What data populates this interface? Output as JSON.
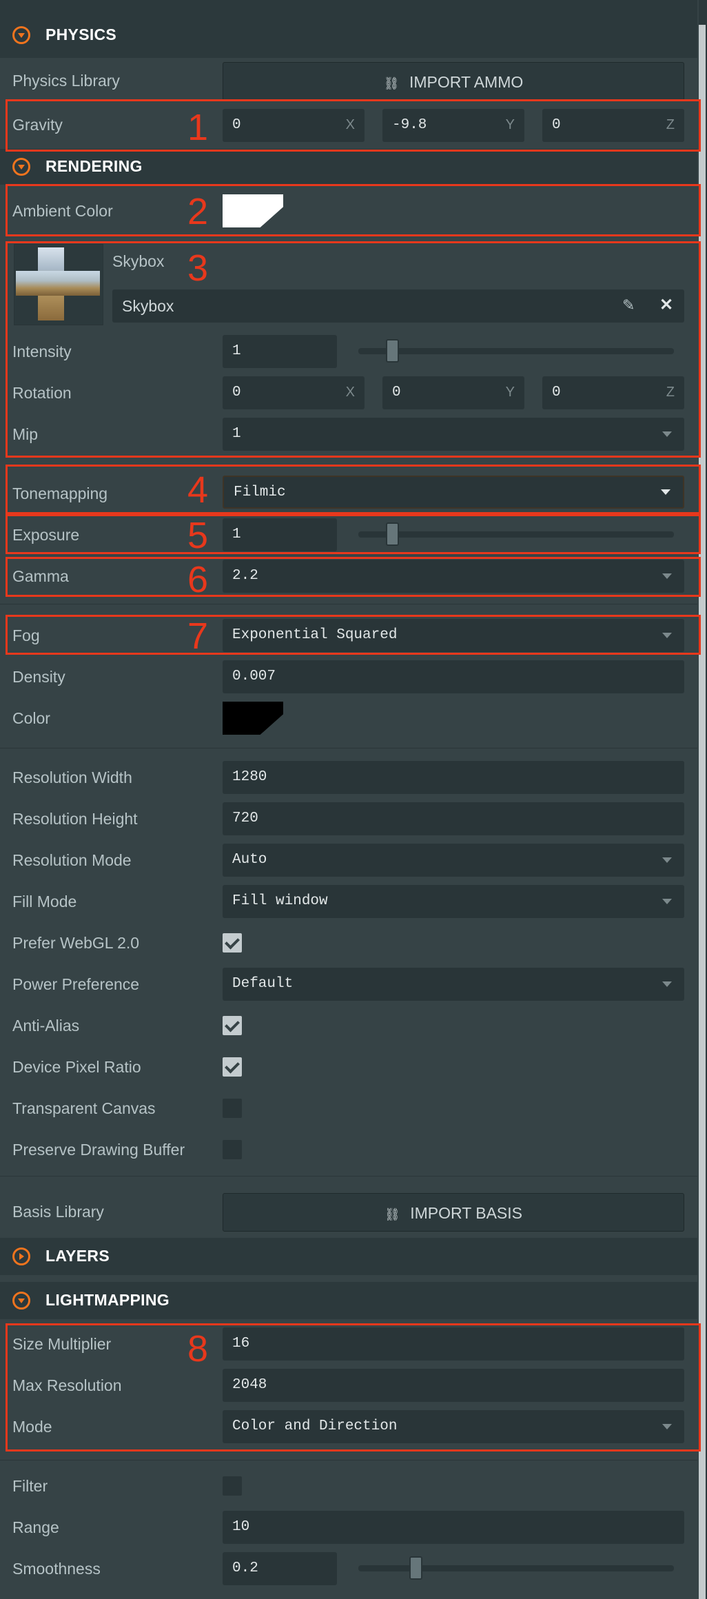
{
  "physics": {
    "title": "PHYSICS",
    "library_label": "Physics Library",
    "import_button": "IMPORT AMMO",
    "gravity_label": "Gravity",
    "gravity": [
      {
        "value": "0",
        "axis": "X"
      },
      {
        "value": "-9.8",
        "axis": "Y"
      },
      {
        "value": "0",
        "axis": "Z"
      }
    ]
  },
  "rendering": {
    "title": "RENDERING",
    "ambient_label": "Ambient Color",
    "ambient_color": "#ffffff",
    "skybox": {
      "label": "Skybox",
      "asset_name": "Skybox",
      "intensity_label": "Intensity",
      "intensity": "1",
      "intensity_level": 0.05,
      "rotation_label": "Rotation",
      "rotation": [
        {
          "value": "0",
          "axis": "X"
        },
        {
          "value": "0",
          "axis": "Y"
        },
        {
          "value": "0",
          "axis": "Z"
        }
      ],
      "mip_label": "Mip",
      "mip": "1"
    },
    "tonemapping_label": "Tonemapping",
    "tonemapping": "Filmic",
    "exposure_label": "Exposure",
    "exposure": "1",
    "exposure_level": 0.1,
    "gamma_label": "Gamma",
    "gamma": "2.2",
    "fog_label": "Fog",
    "fog": "Exponential Squared",
    "density_label": "Density",
    "density": "0.007",
    "color_label": "Color",
    "fog_color": "#000000",
    "res_width_label": "Resolution Width",
    "res_width": "1280",
    "res_height_label": "Resolution Height",
    "res_height": "720",
    "res_mode_label": "Resolution Mode",
    "res_mode": "Auto",
    "fill_mode_label": "Fill Mode",
    "fill_mode": "Fill window",
    "webgl2_label": "Prefer WebGL 2.0",
    "webgl2": true,
    "power_label": "Power Preference",
    "power": "Default",
    "antialias_label": "Anti-Alias",
    "antialias": true,
    "dpr_label": "Device Pixel Ratio",
    "dpr": true,
    "transparent_label": "Transparent Canvas",
    "transparent": false,
    "preserve_label": "Preserve Drawing Buffer",
    "preserve": false,
    "basis_label": "Basis Library",
    "basis_button": "IMPORT BASIS"
  },
  "layers": {
    "title": "LAYERS"
  },
  "lightmapping": {
    "title": "LIGHTMAPPING",
    "size_mult_label": "Size Multiplier",
    "size_mult": "16",
    "max_res_label": "Max Resolution",
    "max_res": "2048",
    "mode_label": "Mode",
    "mode": "Color and Direction",
    "filter_label": "Filter",
    "filter": false,
    "range_label": "Range",
    "range": "10",
    "smoothness_label": "Smoothness",
    "smoothness": "0.2",
    "smoothness_level": 0.2
  },
  "markers": [
    "1",
    "2",
    "3",
    "4",
    "5",
    "6",
    "7",
    "8"
  ],
  "colors": {
    "accent": "#f0741e",
    "highlight": "#e8381c"
  }
}
